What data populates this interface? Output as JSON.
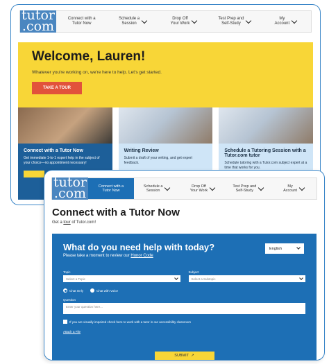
{
  "back_window": {
    "nav": {
      "logo_line1": "tutor",
      "logo_line2": ".com",
      "items": [
        {
          "label": "Connect with a\nTutor Now"
        },
        {
          "label": "Schedule a\nSession"
        },
        {
          "label": "Drop Off\nYour Work"
        },
        {
          "label": "Test Prep and\nSelf-Study"
        },
        {
          "label": "My\nAccount"
        }
      ]
    },
    "hero": {
      "title": "Welcome, Lauren!",
      "subtitle": "Whatever you're working on, we're here to help. Let's get started.",
      "button": "TAKE A TOUR"
    },
    "cards": [
      {
        "title": "Connect with a Tutor Now",
        "desc": "Get immediate 1-to-1 expert help in the subject of your choice—no appointment necessary!"
      },
      {
        "title": "Writing Review",
        "desc": "Submit a draft of your writing, and get expert feedback."
      },
      {
        "title": "Schedule a Tutoring Session with a Tutor.com tutor",
        "desc": "Schedule tutoring with a Tutor.com subject expert at a time that works for you."
      }
    ]
  },
  "front_window": {
    "nav": {
      "logo_line1": "tutor",
      "logo_line2": ".com",
      "items": [
        {
          "label": "Connect with a\nTutor Now"
        },
        {
          "label": "Schedule a\nSession"
        },
        {
          "label": "Drop Off\nYour Work"
        },
        {
          "label": "Test Prep and\nSelf-Study"
        },
        {
          "label": "My\nAccount"
        }
      ]
    },
    "page_title": "Connect with a Tutor Now",
    "subtitle_pre": "Get a ",
    "subtitle_link": "tour",
    "subtitle_post": " of Tutor.com!",
    "form": {
      "heading": "What do you need help with today?",
      "review_pre": "Please take a moment to review our ",
      "review_link": "Honor Code",
      "language": "English",
      "topic_label": "Topic",
      "topic_placeholder": "Select a Topic",
      "subject_label": "Subject",
      "subject_placeholder": "Select a Subtopic",
      "radio_chat_only": "Chat Only",
      "radio_chat_voice": "Chat with Voice",
      "question_label": "Question",
      "question_placeholder": "Enter your question here...",
      "accessibility": "If you are visually impaired check here to work with a tutor in our accessibility classroom",
      "attach": "Attach a File",
      "submit": "SUBMIT"
    }
  },
  "colors": {
    "brand_blue": "#1d6fb5",
    "yellow": "#f8d637",
    "tour_red": "#e2523b",
    "frame_border": "#3a86c8"
  }
}
